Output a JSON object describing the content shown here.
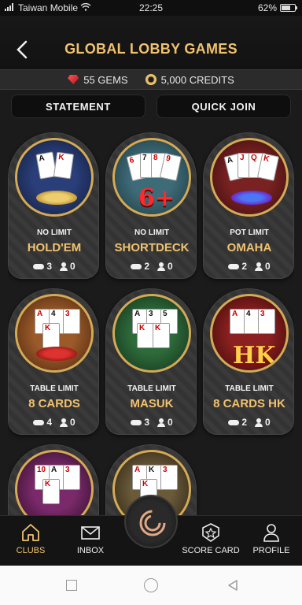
{
  "status_bar": {
    "carrier": "Taiwan Mobile",
    "time": "22:25",
    "battery": "62%"
  },
  "header": {
    "title": "GLOBAL LOBBY GAMES"
  },
  "balance": {
    "gems": "55 GEMS",
    "credits": "5,000 CREDITS"
  },
  "actions": {
    "statement": "STATEMENT",
    "quick_join": "QUICK JOIN"
  },
  "games": [
    {
      "limit": "NO LIMIT",
      "name": "HOLD'EM",
      "tables": "3",
      "players": "0"
    },
    {
      "limit": "NO LIMIT",
      "name": "SHORTDECK",
      "tables": "2",
      "players": "0"
    },
    {
      "limit": "POT LIMIT",
      "name": "OMAHA",
      "tables": "2",
      "players": "0"
    },
    {
      "limit": "TABLE LIMIT",
      "name": "8 CARDS",
      "tables": "4",
      "players": "0"
    },
    {
      "limit": "TABLE LIMIT",
      "name": "MASUK",
      "tables": "3",
      "players": "0"
    },
    {
      "limit": "TABLE LIMIT",
      "name": "8 CARDS HK",
      "tables": "2",
      "players": "0"
    }
  ],
  "art_text": {
    "shortdeck": "6+",
    "hk": "HK"
  },
  "nav": {
    "clubs": "CLUBS",
    "inbox": "INBOX",
    "score_card": "SCORE CARD",
    "profile": "PROFILE"
  },
  "colors": {
    "accent": "#f1c26e",
    "background": "#1b1b1b"
  }
}
